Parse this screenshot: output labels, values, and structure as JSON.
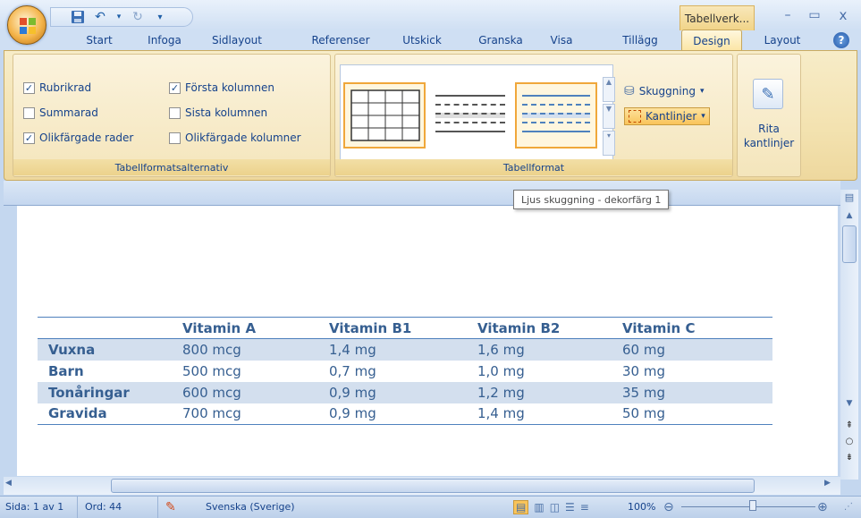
{
  "titlebar": {
    "contextual_tab": "Tabellverk...",
    "minimize": "–",
    "maximize": "▭",
    "close": "x"
  },
  "tabs": [
    "Start",
    "Infoga",
    "Sidlayout",
    "Referenser",
    "Utskick",
    "Granska",
    "Visa",
    "Tillägg",
    "Design",
    "Layout"
  ],
  "ribbon": {
    "options": {
      "group_label": "Tabellformatsalternativ",
      "items": [
        {
          "label": "Rubrikrad",
          "checked": true
        },
        {
          "label": "Summarad",
          "checked": false
        },
        {
          "label": "Olikfärgade rader",
          "checked": true
        },
        {
          "label": "Första kolumnen",
          "checked": true
        },
        {
          "label": "Sista kolumnen",
          "checked": false
        },
        {
          "label": "Olikfärgade kolumner",
          "checked": false
        }
      ]
    },
    "styles": {
      "group_label": "Tabellformat",
      "shading_label": "Skuggning",
      "borders_label": "Kantlinjer"
    },
    "draw": {
      "label_line1": "Rita",
      "label_line2": "kantlinjer"
    }
  },
  "tooltip": "Ljus skuggning - dekorfärg 1",
  "document_table": {
    "headers": [
      "",
      "Vitamin A",
      "Vitamin B1",
      "Vitamin B2",
      "Vitamin C"
    ],
    "rows": [
      [
        "Vuxna",
        "800 mcg",
        "1,4 mg",
        "1,6 mg",
        "60 mg"
      ],
      [
        "Barn",
        "500 mcg",
        "0,7 mg",
        "1,0 mg",
        "30 mg"
      ],
      [
        "Tonåringar",
        "600 mcg",
        "0,9 mg",
        "1,2 mg",
        "35 mg"
      ],
      [
        "Gravida",
        "700 mcg",
        "0,9 mg",
        "1,4 mg",
        "50 mg"
      ]
    ]
  },
  "status": {
    "page": "Sida: 1 av 1",
    "words": "Ord: 44",
    "language": "Svenska (Sverige)",
    "zoom": "100%"
  },
  "colors": {
    "accent": "#4f81bd",
    "row_shade": "#d3dfee",
    "text": "#365f91"
  }
}
